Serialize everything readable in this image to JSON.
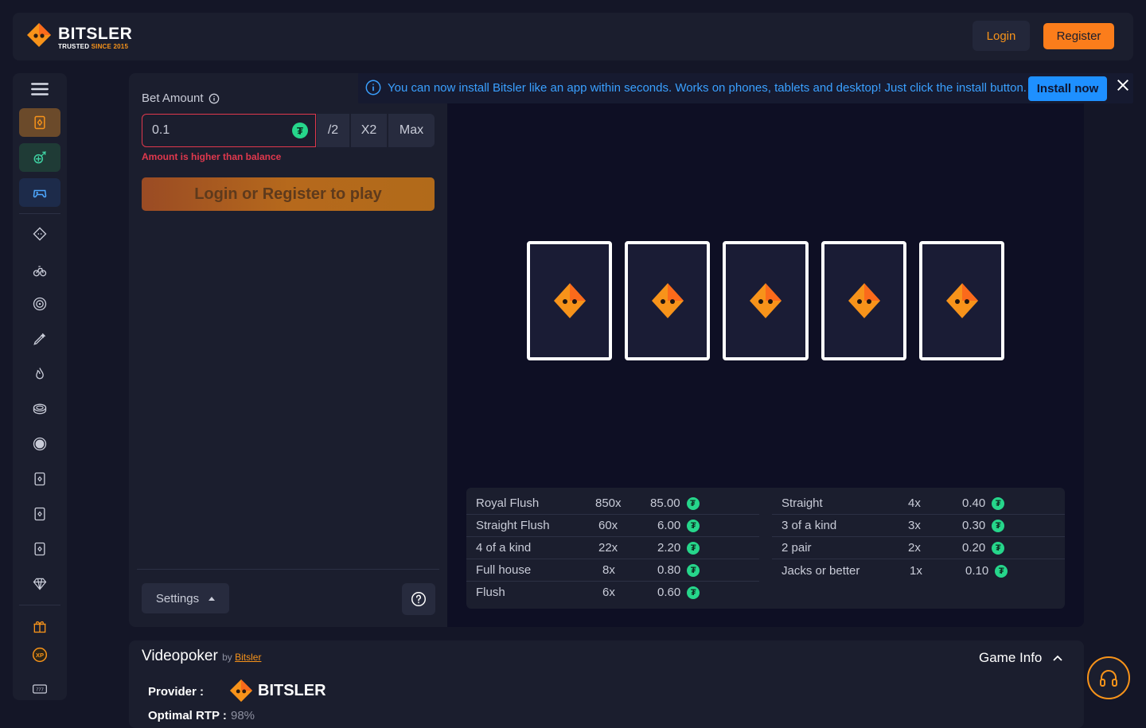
{
  "header": {
    "brand": "BITSLER",
    "tagline_prefix": "TRUSTED",
    "tagline_suffix": "SINCE 2015",
    "login_label": "Login",
    "register_label": "Register"
  },
  "sidebar": {
    "items": [
      {
        "icon": "menu-icon"
      },
      {
        "icon": "card-icon",
        "active": true
      },
      {
        "icon": "sports-ball-icon"
      },
      {
        "icon": "gamepad-icon"
      },
      {
        "icon": "dice-icon"
      },
      {
        "icon": "bike-icon"
      },
      {
        "icon": "roulette-icon"
      },
      {
        "icon": "pen-icon"
      },
      {
        "icon": "flame-icon"
      },
      {
        "icon": "coin-stack-icon"
      },
      {
        "icon": "circle-icon"
      },
      {
        "icon": "card-icon"
      },
      {
        "icon": "card-icon"
      },
      {
        "icon": "card-icon"
      },
      {
        "icon": "diamond-icon"
      },
      {
        "icon": "gift-icon"
      },
      {
        "icon": "xp-icon"
      },
      {
        "icon": "slot-777-icon"
      }
    ]
  },
  "bet": {
    "label": "Bet Amount",
    "value": "0.1",
    "half_label": "/2",
    "double_label": "X2",
    "max_label": "Max",
    "error": "Amount is higher than balance",
    "play_label": "Login or Register to play",
    "settings_label": "Settings",
    "currency_icon": "tether-icon"
  },
  "banner": {
    "text": "You can now install Bitsler like an app within seconds. Works on phones, tablets and desktop! Just click the install button.",
    "button_label": "Install now",
    "close_icon": "close-icon"
  },
  "cards": [
    "card-back",
    "card-back",
    "card-back",
    "card-back",
    "card-back"
  ],
  "paytable": {
    "left": [
      {
        "name": "Royal Flush",
        "mult": "850x",
        "amount": "85.00"
      },
      {
        "name": "Straight Flush",
        "mult": "60x",
        "amount": "6.00"
      },
      {
        "name": "4 of a kind",
        "mult": "22x",
        "amount": "2.20"
      },
      {
        "name": "Full house",
        "mult": "8x",
        "amount": "0.80"
      },
      {
        "name": "Flush",
        "mult": "6x",
        "amount": "0.60"
      }
    ],
    "right": [
      {
        "name": "Straight",
        "mult": "4x",
        "amount": "0.40"
      },
      {
        "name": "3 of a kind",
        "mult": "3x",
        "amount": "0.30"
      },
      {
        "name": "2 pair",
        "mult": "2x",
        "amount": "0.20"
      },
      {
        "name": "Jacks or better",
        "mult": "1x",
        "amount": "0.10"
      }
    ]
  },
  "info": {
    "title": "Videopoker",
    "by_label": "by",
    "by_link": "Bitsler",
    "game_info_label": "Game Info",
    "provider_label": "Provider :",
    "provider_name": "BITSLER",
    "rtp_label": "Optimal RTP :",
    "rtp_value": "98%"
  },
  "colors": {
    "accent": "#fb7d1b",
    "error": "#e0384d",
    "tether": "#26d68b",
    "banner_text": "#3aa0ff"
  }
}
